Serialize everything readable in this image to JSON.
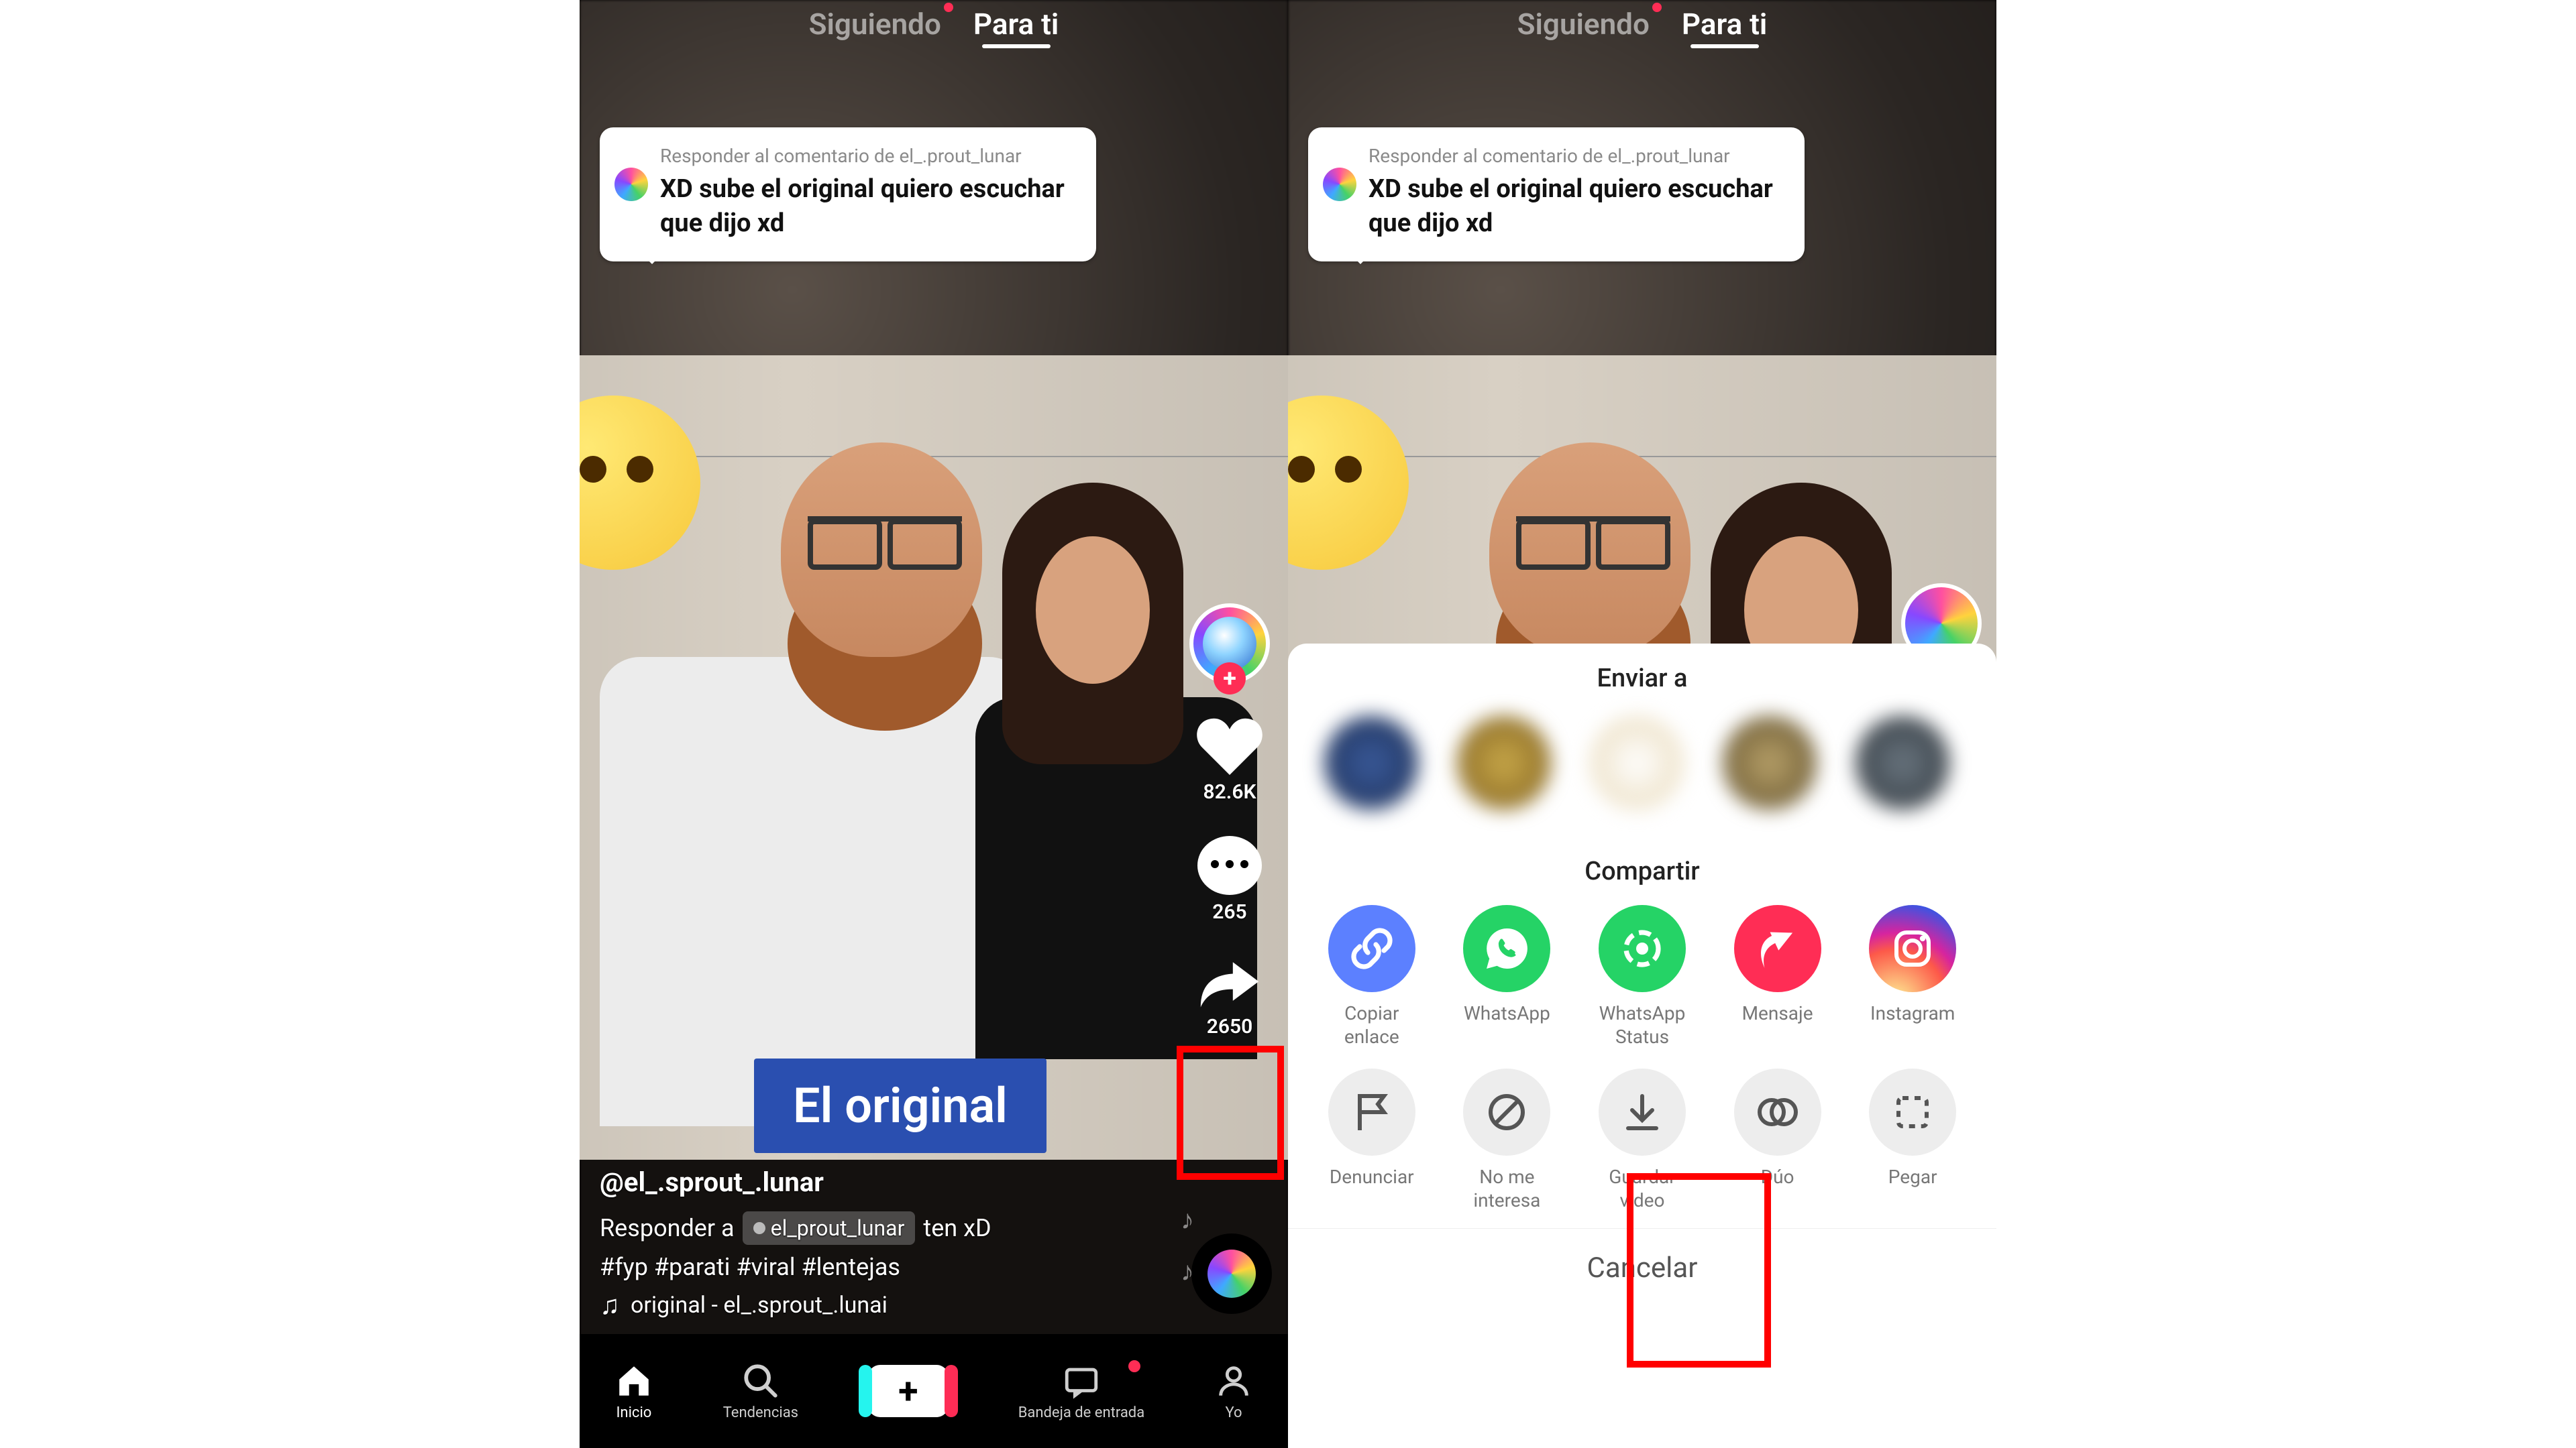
{
  "tabs": {
    "following": "Siguiendo",
    "foryou": "Para ti"
  },
  "comment": {
    "replyTo": "Responder al comentario de el_.prout_lunar",
    "text": "XD sube el original quiero escuchar que dijo xd"
  },
  "caption": "El original",
  "rail": {
    "likes": "82.6K",
    "comments": "265",
    "shares": "2650"
  },
  "info": {
    "user": "@el_.sprout_.lunar",
    "replyPrefix": "Responder a",
    "replyUser": "el_prout_lunar",
    "replySuffix": "ten xD",
    "hashtags": "#fyp #parati #viral #lentejas",
    "sound": "original - el_.sprout_.lunai"
  },
  "nav": {
    "home": "Inicio",
    "trends": "Tendencias",
    "inbox": "Bandeja de entrada",
    "me": "Yo"
  },
  "sheet": {
    "sendTo": "Enviar a",
    "share": "Compartir",
    "options1": [
      {
        "label": "Copiar enlace"
      },
      {
        "label": "WhatsApp"
      },
      {
        "label": "WhatsApp Status"
      },
      {
        "label": "Mensaje"
      },
      {
        "label": "Instagram"
      }
    ],
    "options2": [
      {
        "label": "Denunciar"
      },
      {
        "label": "No me interesa"
      },
      {
        "label": "Guardar video"
      },
      {
        "label": "Dúo"
      },
      {
        "label": "Pegar"
      }
    ],
    "cancel": "Cancelar"
  }
}
